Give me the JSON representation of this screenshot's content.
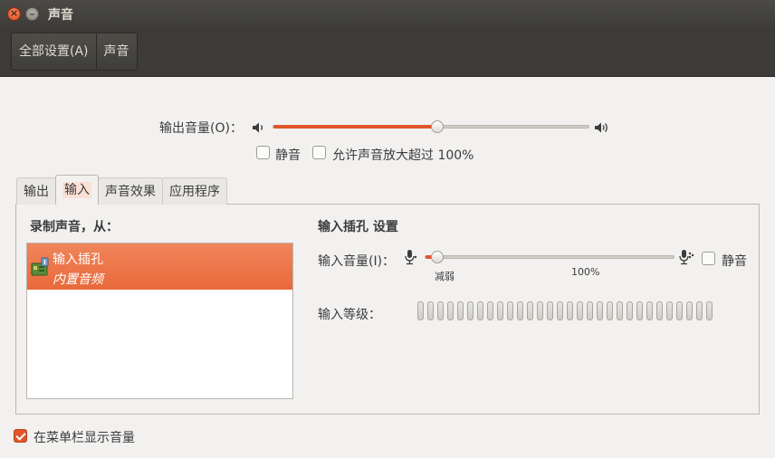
{
  "window": {
    "title": "声音"
  },
  "toolbar": {
    "crumbs": [
      "全部设置(A)",
      "声音"
    ]
  },
  "output_volume": {
    "label": "输出音量(O)：",
    "level_percent": 52,
    "mute_label": "静音",
    "mute_checked": false,
    "amplify_label": "允许声音放大超过 100%",
    "amplify_checked": false
  },
  "tabs": [
    "输出",
    "输入",
    "声音效果",
    "应用程序"
  ],
  "active_tab": "输入",
  "input": {
    "record_heading": "录制声音，从：",
    "devices": [
      {
        "name": "输入插孔",
        "description": "内置音频"
      }
    ],
    "settings_heading": "输入插孔 设置",
    "volume_label": "输入音量(I)：",
    "volume_level_percent": 5,
    "tick_low": "减弱",
    "tick_100": "100%",
    "mute_label": "静音",
    "mute_checked": false,
    "level_label": "输入等级：",
    "meter_segments": 30
  },
  "footer": {
    "show_in_menubar_label": "在菜单栏显示音量",
    "show_in_menubar_checked": true
  },
  "colors": {
    "accent": "#e0562b",
    "titlebar": "#3c3b37"
  }
}
